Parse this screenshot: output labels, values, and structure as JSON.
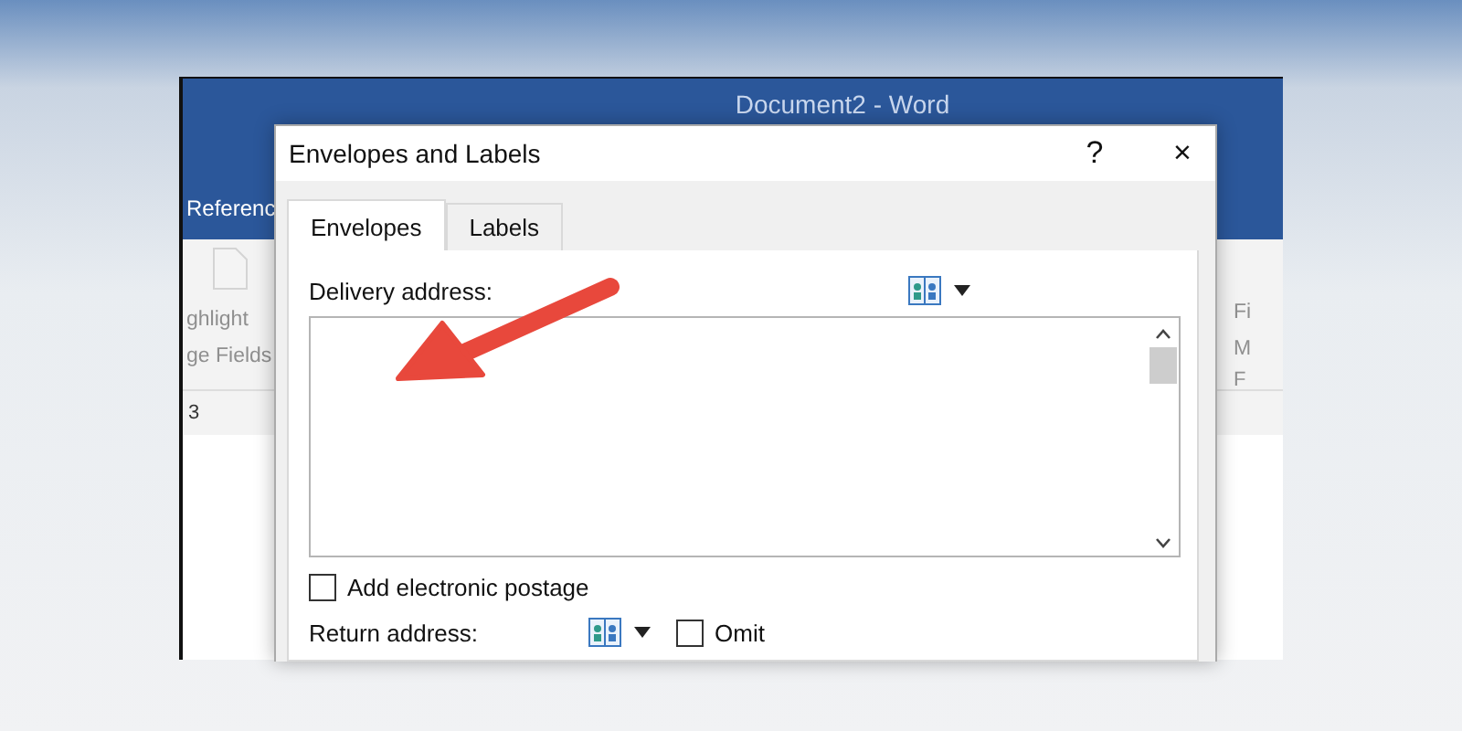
{
  "word_window": {
    "title": "Document2  -  Word",
    "ribbon_tab": "Referenc",
    "ribbon_left": [
      "ghlight",
      "ge Fields"
    ],
    "ribbon_right": [
      "Fi",
      "M"
    ],
    "ribbon_right_group": "F",
    "ruler_number": "3"
  },
  "dialog": {
    "title": "Envelopes and Labels",
    "help": "?",
    "close": "×",
    "tabs": [
      {
        "label": "Envelopes",
        "selected": true
      },
      {
        "label": "Labels",
        "selected": false
      }
    ],
    "delivery_address": {
      "label": "Delivery address:"
    },
    "electronic_postage": {
      "label": "Add electronic postage",
      "checked": false
    },
    "return_address": {
      "label": "Return address:"
    },
    "omit": {
      "label": "Omit",
      "checked": false
    }
  }
}
